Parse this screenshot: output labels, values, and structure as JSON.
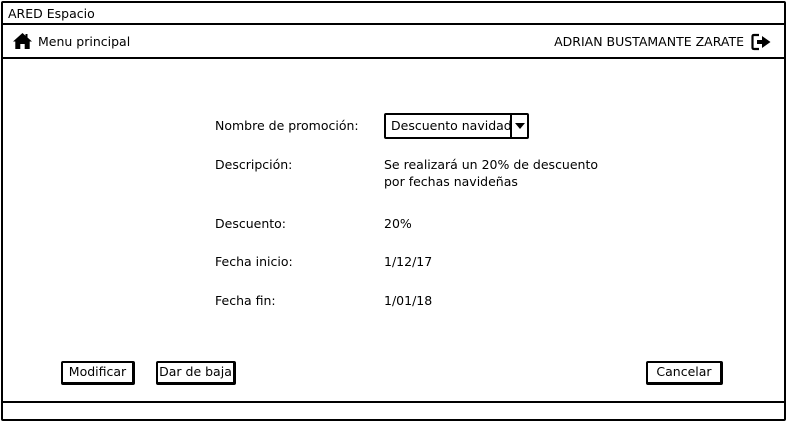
{
  "window": {
    "title": "ARED Espacio"
  },
  "navbar": {
    "home_icon": "home-icon",
    "home_label": "Menu principal",
    "user_name": "ADRIAN BUSTAMANTE ZARATE",
    "logout_icon": "sign-out-icon"
  },
  "form": {
    "promotion_name": {
      "label": "Nombre de promoción:",
      "selected": "Descuento navidad"
    },
    "description": {
      "label": "Descripción:",
      "line1": "Se realizará un 20% de descuento",
      "line2": "por fechas navideñas"
    },
    "discount": {
      "label": "Descuento:",
      "value": "20%"
    },
    "start_date": {
      "label": "Fecha inicio:",
      "value": "1/12/17"
    },
    "end_date": {
      "label": "Fecha fin:",
      "value": "1/01/18"
    }
  },
  "buttons": {
    "modify": "Modificar",
    "deactivate": "Dar de baja",
    "cancel": "Cancelar"
  }
}
